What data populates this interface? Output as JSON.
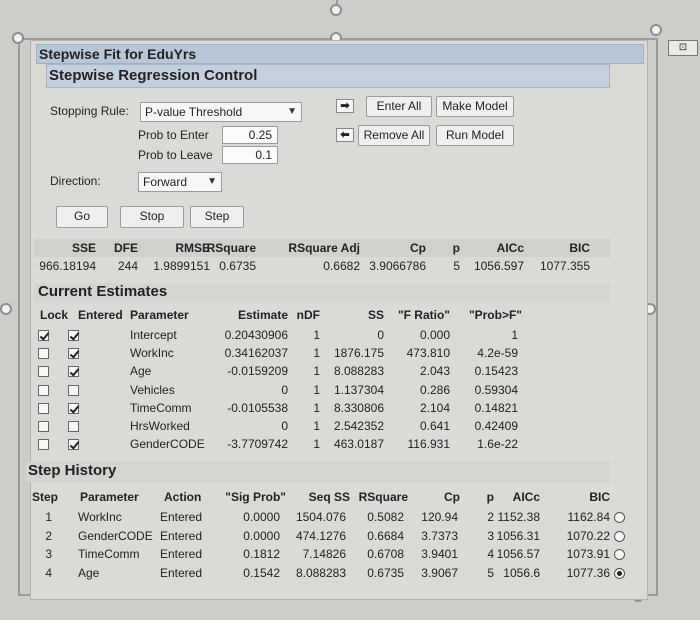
{
  "window": {
    "title": "Stepwise Fit for EduYrs",
    "subtitle": "Stepwise Regression Control"
  },
  "control": {
    "stopping_rule_label": "Stopping Rule:",
    "stopping_rule_value": "P-value Threshold",
    "prob_to_enter_label": "Prob to Enter",
    "prob_to_enter_value": "0.25",
    "prob_to_leave_label": "Prob to Leave",
    "prob_to_leave_value": "0.1",
    "direction_label": "Direction:",
    "direction_value": "Forward",
    "enter_all": "Enter All",
    "remove_all": "Remove All",
    "make_model": "Make Model",
    "run_model": "Run Model",
    "go": "Go",
    "stop": "Stop",
    "step": "Step"
  },
  "stats": {
    "headers": [
      "SSE",
      "DFE",
      "RMSE",
      "RSquare",
      "RSquare Adj",
      "Cp",
      "p",
      "AICc",
      "BIC"
    ],
    "values": [
      "966.18194",
      "244",
      "1.9899151",
      "0.6735",
      "0.6682",
      "3.9066786",
      "5",
      "1056.597",
      "1077.355"
    ]
  },
  "estimates": {
    "title": "Current Estimates",
    "headers": [
      "Lock",
      "Entered",
      "Parameter",
      "Estimate",
      "nDF",
      "SS",
      "\"F Ratio\"",
      "\"Prob>F\""
    ],
    "rows": [
      {
        "lock": true,
        "entered": true,
        "parameter": "Intercept",
        "estimate": "0.20430906",
        "ndf": "1",
        "ss": "0",
        "f": "0.000",
        "p": "1"
      },
      {
        "lock": false,
        "entered": true,
        "parameter": "WorkInc",
        "estimate": "0.34162037",
        "ndf": "1",
        "ss": "1876.175",
        "f": "473.810",
        "p": "4.2e-59"
      },
      {
        "lock": false,
        "entered": true,
        "parameter": "Age",
        "estimate": "-0.0159209",
        "ndf": "1",
        "ss": "8.088283",
        "f": "2.043",
        "p": "0.15423"
      },
      {
        "lock": false,
        "entered": false,
        "parameter": "Vehicles",
        "estimate": "0",
        "ndf": "1",
        "ss": "1.137304",
        "f": "0.286",
        "p": "0.59304"
      },
      {
        "lock": false,
        "entered": true,
        "parameter": "TimeComm",
        "estimate": "-0.0105538",
        "ndf": "1",
        "ss": "8.330806",
        "f": "2.104",
        "p": "0.14821"
      },
      {
        "lock": false,
        "entered": false,
        "parameter": "HrsWorked",
        "estimate": "0",
        "ndf": "1",
        "ss": "2.542352",
        "f": "0.641",
        "p": "0.42409"
      },
      {
        "lock": false,
        "entered": true,
        "parameter": "GenderCODE",
        "estimate": "-3.7709742",
        "ndf": "1",
        "ss": "463.0187",
        "f": "116.931",
        "p": "1.6e-22"
      }
    ]
  },
  "history": {
    "title": "Step History",
    "headers": [
      "Step",
      "Parameter",
      "Action",
      "\"Sig Prob\"",
      "Seq SS",
      "RSquare",
      "Cp",
      "p",
      "AICc",
      "BIC"
    ],
    "rows": [
      {
        "step": "1",
        "parameter": "WorkInc",
        "action": "Entered",
        "sig": "0.0000",
        "seqss": "1504.076",
        "rsq": "0.5082",
        "cp": "120.94",
        "p": "2",
        "aicc": "1152.38",
        "bic": "1162.84",
        "selected": false
      },
      {
        "step": "2",
        "parameter": "GenderCODE",
        "action": "Entered",
        "sig": "0.0000",
        "seqss": "474.1276",
        "rsq": "0.6684",
        "cp": "3.7373",
        "p": "3",
        "aicc": "1056.31",
        "bic": "1070.22",
        "selected": false
      },
      {
        "step": "3",
        "parameter": "TimeComm",
        "action": "Entered",
        "sig": "0.1812",
        "seqss": "7.14826",
        "rsq": "0.6708",
        "cp": "3.9401",
        "p": "4",
        "aicc": "1056.57",
        "bic": "1073.91",
        "selected": false
      },
      {
        "step": "4",
        "parameter": "Age",
        "action": "Entered",
        "sig": "0.1542",
        "seqss": "8.088283",
        "rsq": "0.6735",
        "cp": "3.9067",
        "p": "5",
        "aicc": "1056.6",
        "bic": "1077.36",
        "selected": true
      }
    ]
  }
}
